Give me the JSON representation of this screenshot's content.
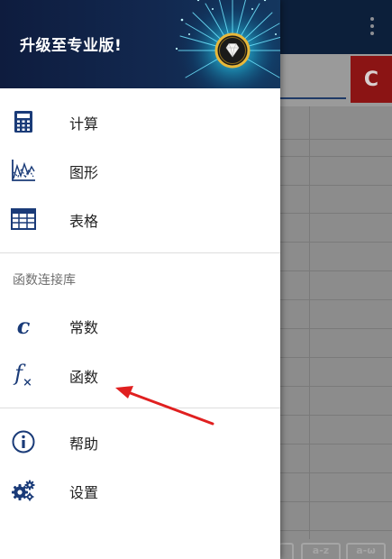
{
  "header": {
    "title": "升级至专业版!",
    "badge_icon": "diamond-icon"
  },
  "menu": {
    "primary": [
      {
        "label": "计算",
        "icon": "calculator-icon"
      },
      {
        "label": "图形",
        "icon": "graph-icon"
      },
      {
        "label": "表格",
        "icon": "table-icon"
      }
    ],
    "library_title": "函数连接库",
    "library": [
      {
        "label": "常数",
        "icon": "constant-icon",
        "glyph": "c"
      },
      {
        "label": "函数",
        "icon": "function-icon",
        "glyph": "f"
      }
    ],
    "secondary": [
      {
        "label": "帮助",
        "icon": "info-icon"
      },
      {
        "label": "设置",
        "icon": "settings-icon"
      }
    ]
  },
  "background": {
    "clear_button": "C",
    "keys": [
      "a-z",
      "a-ω"
    ]
  },
  "colors": {
    "accent": "#1a3b78",
    "annotation_arrow": "#e02020",
    "header_bg": "#0e1c3e"
  }
}
